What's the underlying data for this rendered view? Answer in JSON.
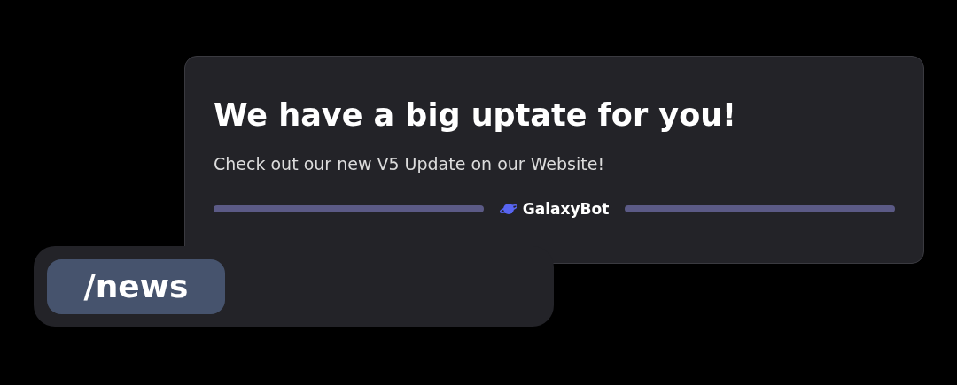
{
  "embed": {
    "title": "We have a big uptate for you!",
    "description": "Check out our new V5 Update on our Website!",
    "footer": {
      "bot_name": "GalaxyBot"
    }
  },
  "message_input": {
    "command": "/news"
  }
}
